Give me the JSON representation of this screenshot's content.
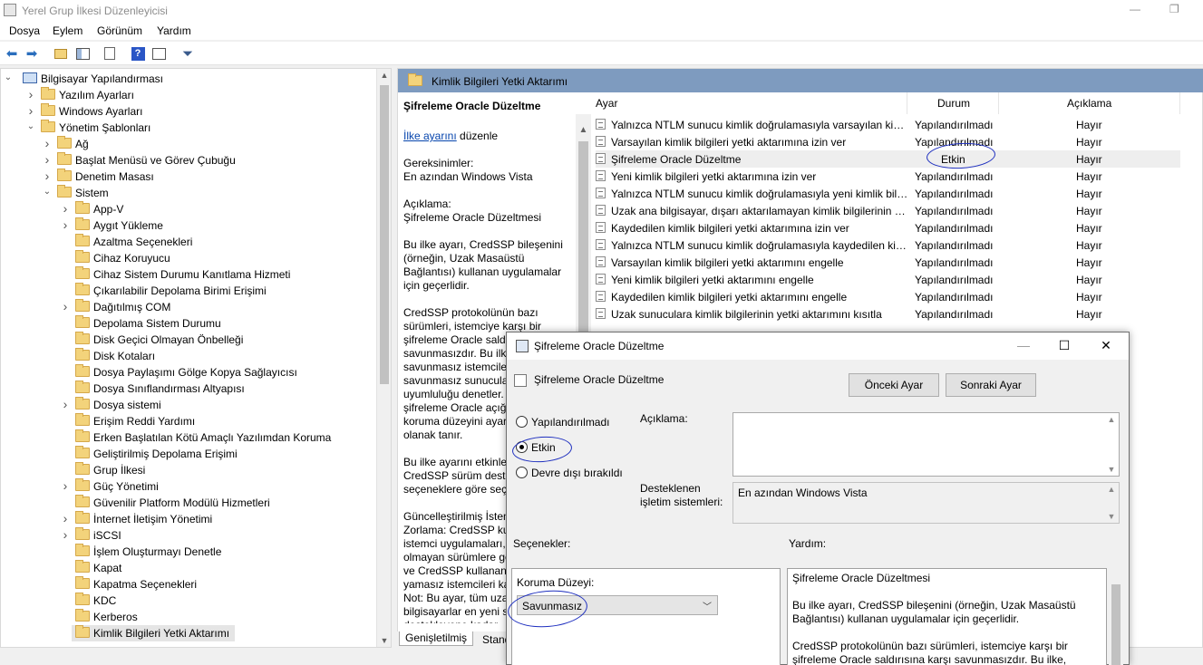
{
  "window": {
    "title": "Yerel Grup İlkesi Düzenleyicisi"
  },
  "menu": [
    "Dosya",
    "Eylem",
    "Görünüm",
    "Yardım"
  ],
  "tree": {
    "items": [
      {
        "label": "Bilgisayar Yapılandırması",
        "level": 0,
        "expanded": true,
        "chevron": "down",
        "icon": "computer"
      },
      {
        "label": "Yazılım Ayarları",
        "level": 1,
        "chevron": "right"
      },
      {
        "label": "Windows Ayarları",
        "level": 1,
        "chevron": "right"
      },
      {
        "label": "Yönetim Şablonları",
        "level": 1,
        "chevron": "down"
      },
      {
        "label": "Ağ",
        "level": 2,
        "chevron": "right"
      },
      {
        "label": "Başlat Menüsü ve Görev Çubuğu",
        "level": 2,
        "chevron": "right"
      },
      {
        "label": "Denetim Masası",
        "level": 2,
        "chevron": "right"
      },
      {
        "label": "Sistem",
        "level": 2,
        "chevron": "down"
      },
      {
        "label": "App-V",
        "level": 3,
        "chevron": "right"
      },
      {
        "label": "Aygıt Yükleme",
        "level": 3,
        "chevron": "right"
      },
      {
        "label": "Azaltma Seçenekleri",
        "level": 3,
        "chevron": ""
      },
      {
        "label": "Cihaz Koruyucu",
        "level": 3,
        "chevron": ""
      },
      {
        "label": "Cihaz Sistem Durumu Kanıtlama Hizmeti",
        "level": 3,
        "chevron": ""
      },
      {
        "label": "Çıkarılabilir Depolama Birimi Erişimi",
        "level": 3,
        "chevron": ""
      },
      {
        "label": "Dağıtılmış COM",
        "level": 3,
        "chevron": "right"
      },
      {
        "label": "Depolama Sistem Durumu",
        "level": 3,
        "chevron": ""
      },
      {
        "label": "Disk Geçici Olmayan Önbelleği",
        "level": 3,
        "chevron": ""
      },
      {
        "label": "Disk Kotaları",
        "level": 3,
        "chevron": ""
      },
      {
        "label": "Dosya Paylaşımı Gölge Kopya Sağlayıcısı",
        "level": 3,
        "chevron": ""
      },
      {
        "label": "Dosya Sınıflandırması Altyapısı",
        "level": 3,
        "chevron": ""
      },
      {
        "label": "Dosya sistemi",
        "level": 3,
        "chevron": "right"
      },
      {
        "label": "Erişim Reddi Yardımı",
        "level": 3,
        "chevron": ""
      },
      {
        "label": "Erken Başlatılan Kötü Amaçlı Yazılımdan Koruma",
        "level": 3,
        "chevron": ""
      },
      {
        "label": "Geliştirilmiş Depolama Erişimi",
        "level": 3,
        "chevron": ""
      },
      {
        "label": "Grup İlkesi",
        "level": 3,
        "chevron": ""
      },
      {
        "label": "Güç Yönetimi",
        "level": 3,
        "chevron": "right"
      },
      {
        "label": "Güvenilir Platform Modülü Hizmetleri",
        "level": 3,
        "chevron": ""
      },
      {
        "label": "İnternet İletişim Yönetimi",
        "level": 3,
        "chevron": "right"
      },
      {
        "label": "iSCSI",
        "level": 3,
        "chevron": "right"
      },
      {
        "label": "İşlem Oluşturmayı Denetle",
        "level": 3,
        "chevron": ""
      },
      {
        "label": "Kapat",
        "level": 3,
        "chevron": ""
      },
      {
        "label": "Kapatma Seçenekleri",
        "level": 3,
        "chevron": ""
      },
      {
        "label": "KDC",
        "level": 3,
        "chevron": ""
      },
      {
        "label": "Kerberos",
        "level": 3,
        "chevron": ""
      },
      {
        "label": "Kimlik Bilgileri Yetki Aktarımı",
        "level": 3,
        "chevron": "",
        "selected": true
      }
    ]
  },
  "header": {
    "path_title": "Kimlik Bilgileri Yetki Aktarımı"
  },
  "description": {
    "heading": "Şifreleme Oracle Düzeltme",
    "edit_link": "İlke ayarını",
    "edit_suffix": " düzenle",
    "requirements_label": "Gereksinimler:",
    "requirements_value": "En azından Windows Vista",
    "desc_label": "Açıklama:",
    "desc_value": "Şifreleme Oracle Düzeltmesi",
    "para1": "Bu ilke ayarı, CredSSP bileşenini (örneğin, Uzak Masaüstü Bağlantısı) kullanan uygulamalar için geçerlidir.",
    "para2": "CredSSP protokolünün bazı sürümleri, istemciye karşı bir şifreleme Oracle saldırısına karşı savunmasızdır. Bu ilke, savunmasız istemcilerle ve savunmasız sunucularla uyumluluğu denetler. Bu ilke, şifreleme Oracle açığı için istenen koruma düzeyini ayarlamanıza olanak tanır.",
    "para3": "Bu ilke ayarını etkinleştirirseniz, CredSSP sürüm desteği aşağıdaki seçeneklere göre seçilecektir:",
    "para4": "Güncelleştirilmiş İstemcileri Zorlama: CredSSP kullanan istemci uygulamaları, güvenli olmayan sürümlere geri dönemez ve CredSSP kullanan hizmetler yamasız istemcileri kabul etmez. Not: Bu ayar, tüm uzak ana bilgisayarlar en yeni sürümü destekleyene kadar dağıtılmamalıdır."
  },
  "bottom_tabs": [
    "Genişletilmiş",
    "Standart"
  ],
  "list": {
    "columns": [
      "Ayar",
      "Durum",
      "Açıklama"
    ],
    "rows": [
      {
        "name": "Yalnızca NTLM sunucu kimlik doğrulamasıyla varsayılan kimlik bilgileri yetki aktarımına izin ver",
        "state": "Yapılandırılmadı",
        "comment": "Hayır"
      },
      {
        "name": "Varsayılan kimlik bilgileri yetki aktarımına izin ver",
        "state": "Yapılandırılmadı",
        "comment": "Hayır"
      },
      {
        "name": "Şifreleme Oracle Düzeltme",
        "state": "Etkin",
        "comment": "Hayır",
        "selected": true
      },
      {
        "name": "Yeni kimlik bilgileri yetki aktarımına izin ver",
        "state": "Yapılandırılmadı",
        "comment": "Hayır"
      },
      {
        "name": "Yalnızca NTLM sunucu kimlik doğrulamasıyla yeni kimlik bilgileri yetki aktarımına izin ver",
        "state": "Yapılandırılmadı",
        "comment": "Hayır"
      },
      {
        "name": "Uzak ana bilgisayar, dışarı aktarılamayan kimlik bilgilerinin yetki aktarımını destekler",
        "state": "Yapılandırılmadı",
        "comment": "Hayır"
      },
      {
        "name": "Kaydedilen kimlik bilgileri yetki aktarımına izin ver",
        "state": "Yapılandırılmadı",
        "comment": "Hayır"
      },
      {
        "name": "Yalnızca NTLM sunucu kimlik doğrulamasıyla kaydedilen kimlik bilgileri yetki aktarımına izin ver",
        "state": "Yapılandırılmadı",
        "comment": "Hayır"
      },
      {
        "name": "Varsayılan kimlik bilgileri yetki aktarımını engelle",
        "state": "Yapılandırılmadı",
        "comment": "Hayır"
      },
      {
        "name": "Yeni kimlik bilgileri yetki aktarımını engelle",
        "state": "Yapılandırılmadı",
        "comment": "Hayır"
      },
      {
        "name": "Kaydedilen kimlik bilgileri yetki aktarımını engelle",
        "state": "Yapılandırılmadı",
        "comment": "Hayır"
      },
      {
        "name": "Uzak sunuculara kimlik bilgilerinin yetki aktarımını kısıtla",
        "state": "Yapılandırılmadı",
        "comment": "Hayır"
      }
    ]
  },
  "dialog": {
    "title": "Şifreleme Oracle Düzeltme",
    "subtitle": "Şifreleme Oracle Düzeltme",
    "prev_button": "Önceki Ayar",
    "next_button": "Sonraki Ayar",
    "radio_not_configured": "Yapılandırılmadı",
    "radio_enabled": "Etkin",
    "radio_disabled": "Devre dışı bırakıldı",
    "selected_radio": "enabled",
    "comment_label": "Açıklama:",
    "comment_value": "",
    "supported_label": "Desteklenen\nişletim sistemleri:",
    "supported_value": "En azından Windows Vista",
    "options_label": "Seçenekler:",
    "help_label": "Yardım:",
    "protection_label": "Koruma Düzeyi:",
    "protection_value": "Savunmasız",
    "help_title": "Şifreleme Oracle Düzeltmesi",
    "help_p1": "Bu ilke ayarı, CredSSP bileşenini (örneğin, Uzak Masaüstü Bağlantısı) kullanan uygulamalar için geçerlidir.",
    "help_p2": "CredSSP protokolünün bazı sürümleri, istemciye karşı bir şifreleme Oracle saldırısına karşı savunmasızdır. Bu ilke,"
  },
  "colors": {
    "header_bar": "#7e9bbf",
    "ink": "#1e2fbf",
    "link": "#0645ad"
  }
}
